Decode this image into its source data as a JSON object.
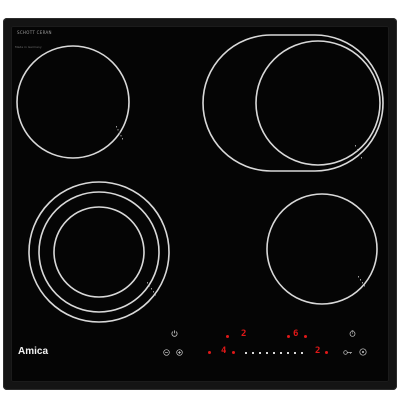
{
  "appliance": {
    "brand": "Amica",
    "glass_brand": "SCHOTT CERAN",
    "made_in": "Made in Germany"
  },
  "controls": {
    "zone_left_power": "4",
    "zone_front_power": "2",
    "zone_rear_power": "6",
    "zone_right_power": "2"
  },
  "icons": {
    "power": "power-icon",
    "minus": "minus-icon",
    "plus": "plus-icon",
    "key_lock": "key-lock-icon",
    "timer": "timer-icon",
    "slider": "power-slider"
  },
  "colors": {
    "glass": "#050505",
    "frame": "#141414",
    "zone_outline": "#d9d9d9",
    "display": "#e01818"
  }
}
